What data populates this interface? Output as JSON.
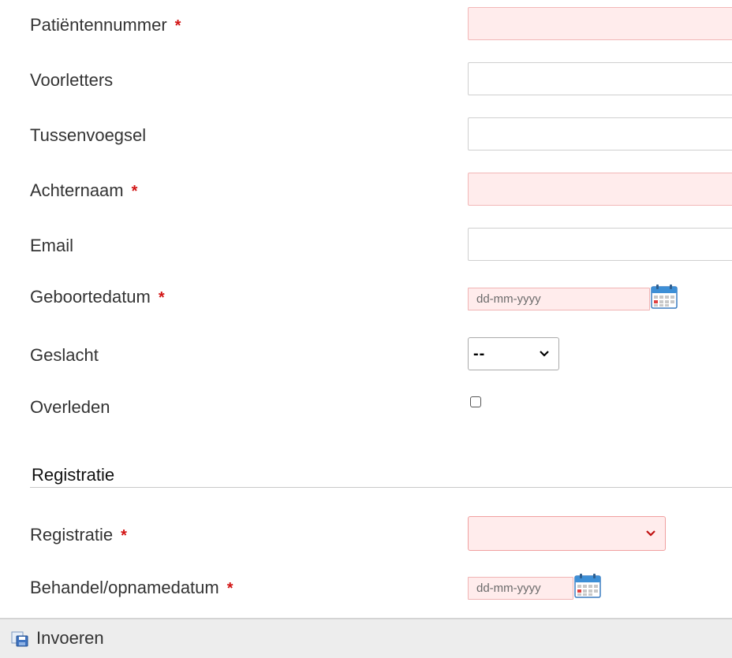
{
  "form": {
    "patient_number": {
      "label": "Patiëntennummer",
      "required_mark": "*",
      "value": ""
    },
    "initials": {
      "label": "Voorletters",
      "value": ""
    },
    "infix": {
      "label": "Tussenvoegsel",
      "value": ""
    },
    "surname": {
      "label": "Achternaam",
      "required_mark": "*",
      "value": ""
    },
    "email": {
      "label": "Email",
      "value": ""
    },
    "birth_date": {
      "label": "Geboortedatum",
      "required_mark": "*",
      "placeholder": "dd-mm-yyyy"
    },
    "gender": {
      "label": "Geslacht",
      "selected": "--"
    },
    "deceased": {
      "label": "Overleden",
      "checked": false
    }
  },
  "registration_section": {
    "title": "Registratie",
    "registration": {
      "label": "Registratie",
      "required_mark": "*",
      "selected": ""
    },
    "treatment_date": {
      "label": "Behandel/opnamedatum",
      "required_mark": "*",
      "placeholder": "dd-mm-yyyy"
    }
  },
  "footer": {
    "submit_label": "Invoeren"
  },
  "icons": {
    "calendar": "calendar-icon",
    "chevron": "chevron-down-icon",
    "submit": "save-icon"
  },
  "colors": {
    "required_mark": "#d21414",
    "required_field_bg": "#ffecec",
    "required_field_border": "#f0b4b4",
    "footer_bg": "#ededed"
  }
}
